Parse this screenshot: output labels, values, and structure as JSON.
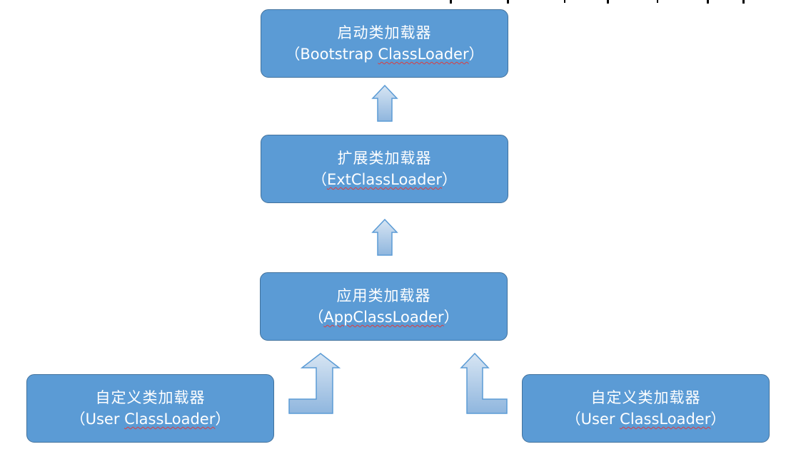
{
  "diagram": {
    "nodes": {
      "bootstrap": {
        "title": "启动类加载器",
        "sub_open": "（Bootstrap ",
        "sub_flag": "ClassLoader",
        "sub_close": "）"
      },
      "ext": {
        "title": "扩展类加载器",
        "sub_open": "（",
        "sub_flag": "ExtClassLoader",
        "sub_close": "）"
      },
      "app": {
        "title": "应用类加载器",
        "sub_open": "（",
        "sub_flag": "AppClassLoader",
        "sub_close": "）"
      },
      "user_left": {
        "title": "自定义类加载器",
        "sub_open": "（User ",
        "sub_flag": "ClassLoader",
        "sub_close": "）"
      },
      "user_right": {
        "title": "自定义类加载器",
        "sub_open": "（User ",
        "sub_flag": "ClassLoader",
        "sub_close": "）"
      }
    },
    "edges": [
      {
        "from": "ext",
        "to": "bootstrap"
      },
      {
        "from": "app",
        "to": "ext"
      },
      {
        "from": "user_left",
        "to": "app"
      },
      {
        "from": "user_right",
        "to": "app"
      }
    ],
    "colors": {
      "box_fill": "#5b9bd5",
      "box_border": "#41719c",
      "box_text": "#ffffff",
      "arrow_fill_top": "#d7e5f3",
      "arrow_fill_bottom": "#8fb6de",
      "arrow_border": "#5b9bd5",
      "spell_underline": "#e03c3c"
    }
  }
}
